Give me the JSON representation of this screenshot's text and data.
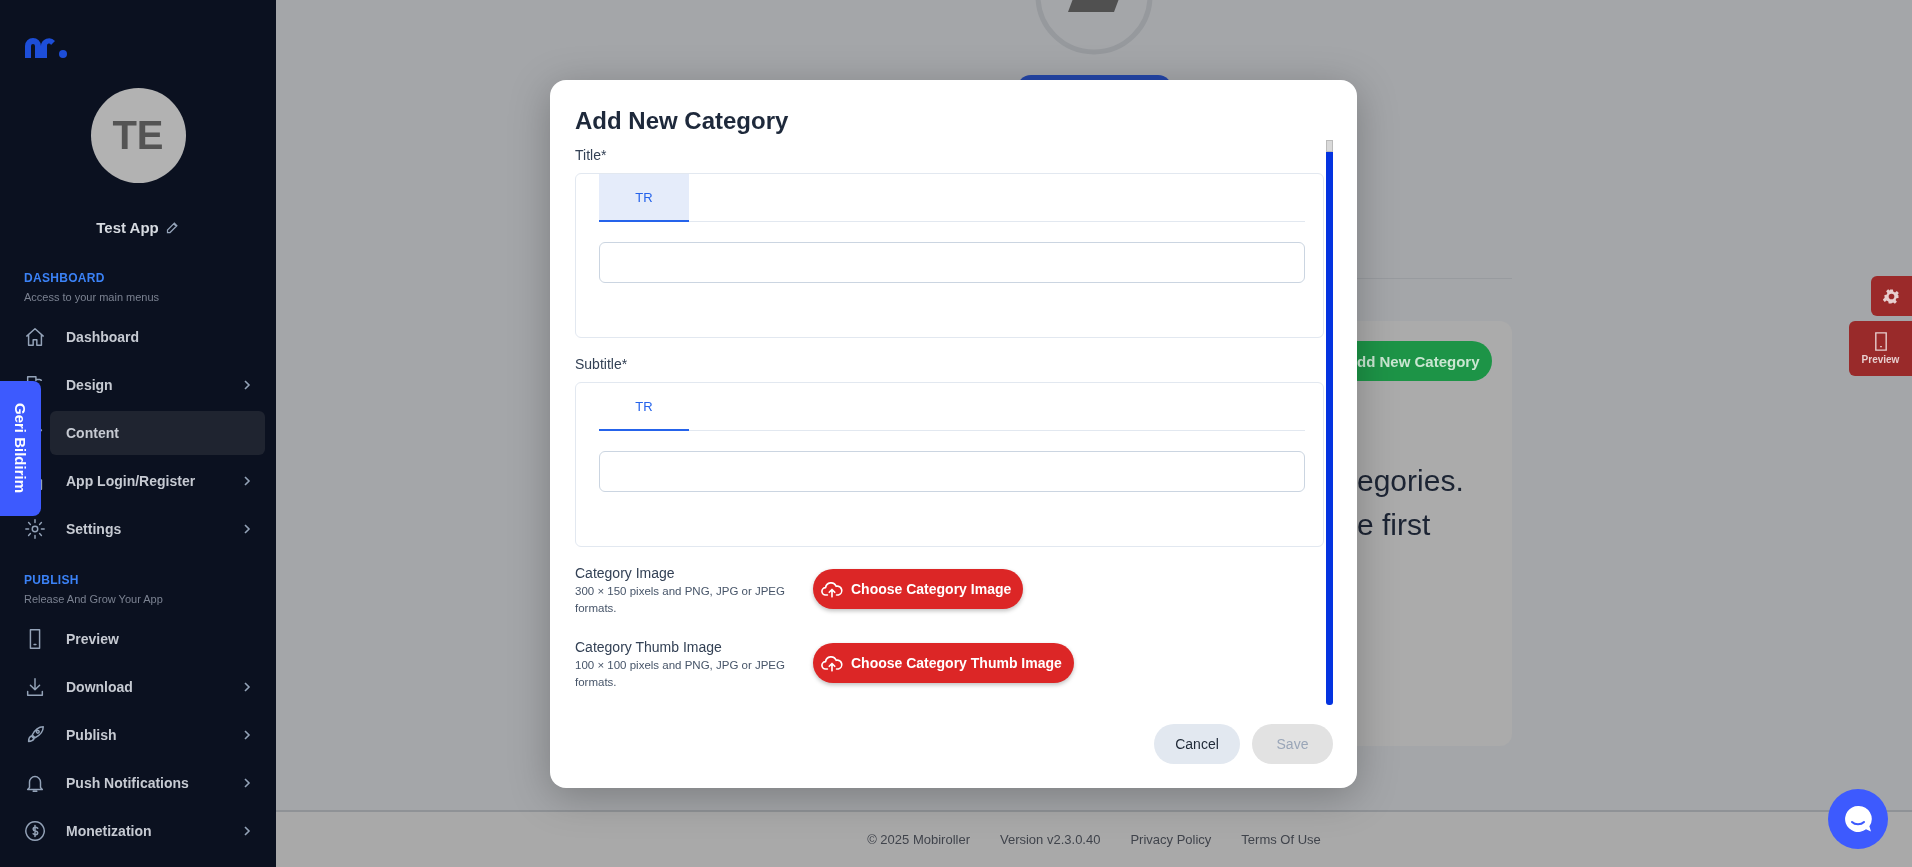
{
  "sidebar": {
    "app_initials": "TE",
    "app_name": "Test App",
    "sections": [
      {
        "title": "DASHBOARD",
        "subtitle": "Access to your main menus",
        "items": [
          {
            "label": "Dashboard",
            "has_submenu": false,
            "selected": false
          },
          {
            "label": "Design",
            "has_submenu": true,
            "selected": false
          },
          {
            "label": "Content",
            "has_submenu": false,
            "selected": true
          },
          {
            "label": "App Login/Register",
            "has_submenu": true,
            "selected": false
          },
          {
            "label": "Settings",
            "has_submenu": true,
            "selected": false
          }
        ]
      },
      {
        "title": "PUBLISH",
        "subtitle": "Release And Grow Your App",
        "items": [
          {
            "label": "Preview",
            "has_submenu": false,
            "selected": false
          },
          {
            "label": "Download",
            "has_submenu": true,
            "selected": false
          },
          {
            "label": "Publish",
            "has_submenu": true,
            "selected": false
          },
          {
            "label": "Push Notifications",
            "has_submenu": true,
            "selected": false
          },
          {
            "label": "Monetization",
            "has_submenu": true,
            "selected": false
          }
        ]
      }
    ]
  },
  "feedback_tab": {
    "label": "Geri Bildirim"
  },
  "background": {
    "add_button": "dd New Category",
    "message_lines": [
      "egories.",
      "e first"
    ]
  },
  "floating": {
    "preview_label": "Preview"
  },
  "modal": {
    "title": "Add New Category",
    "fields": [
      {
        "label": "Title*",
        "tabs": [
          {
            "label": "TR",
            "selected": true,
            "highlighted": true
          }
        ]
      },
      {
        "label": "Subtitle*",
        "tabs": [
          {
            "label": "TR",
            "selected": true,
            "highlighted": false
          }
        ]
      }
    ],
    "uploads": [
      {
        "label": "Category Image",
        "hint": "300 × 150 pixels and PNG, JPG or JPEG formats.",
        "button": "Choose Category Image"
      },
      {
        "label": "Category Thumb Image",
        "hint": "100 × 100 pixels and PNG, JPG or JPEG formats.",
        "button": "Choose Category Thumb Image"
      }
    ],
    "actions": [
      {
        "label": "Cancel",
        "disabled": false
      },
      {
        "label": "Save",
        "disabled": true
      }
    ]
  },
  "footer": {
    "items": [
      "© 2025 Mobiroller",
      "Version v2.3.0.40",
      "Privacy Policy",
      "Terms Of Use"
    ]
  }
}
